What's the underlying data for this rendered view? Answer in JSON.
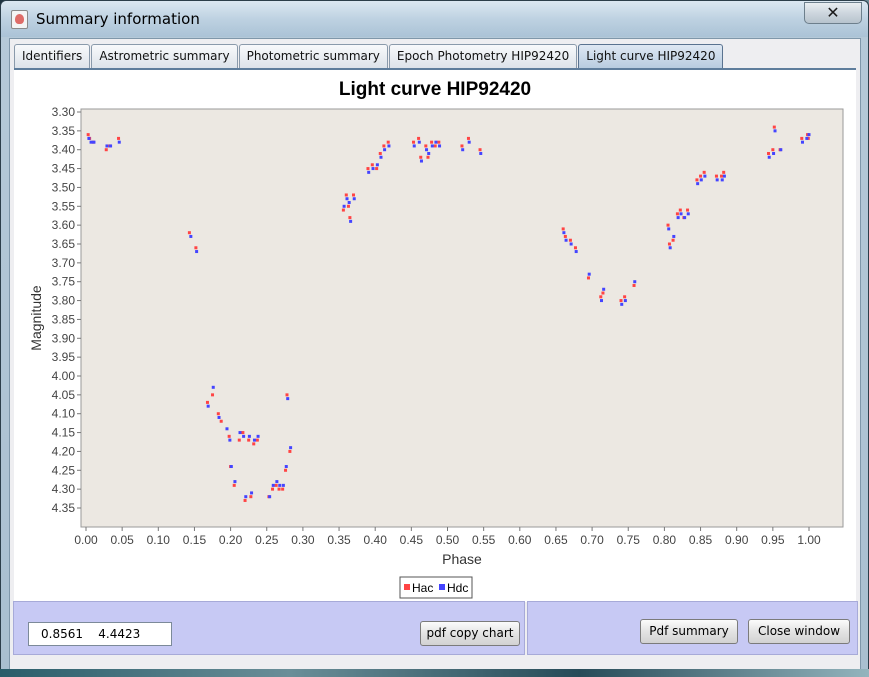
{
  "window": {
    "title": "Summary information",
    "close_icon": "close-icon",
    "app_icon": "java-cup-icon"
  },
  "tabs": [
    {
      "label": "Identifiers",
      "active": false
    },
    {
      "label": "Astrometric summary",
      "active": false
    },
    {
      "label": "Photometric summary",
      "active": false
    },
    {
      "label": "Epoch Photometry HIP92420",
      "active": false
    },
    {
      "label": "Light curve HIP92420",
      "active": true
    }
  ],
  "chart_data": {
    "type": "scatter",
    "title": "Light curve HIP92420",
    "xlabel": "Phase",
    "ylabel": "Magnitude",
    "xlim": [
      0.0,
      1.03
    ],
    "ylim": [
      4.37,
      3.3
    ],
    "y_inverted": true,
    "grid": false,
    "legend_position": "bottom-center",
    "x_ticks": [
      "0.00",
      "0.05",
      "0.10",
      "0.15",
      "0.20",
      "0.25",
      "0.30",
      "0.35",
      "0.40",
      "0.45",
      "0.50",
      "0.55",
      "0.60",
      "0.65",
      "0.70",
      "0.75",
      "0.80",
      "0.85",
      "0.90",
      "0.95",
      "1.00"
    ],
    "y_ticks": [
      "3.30",
      "3.35",
      "3.40",
      "3.45",
      "3.50",
      "3.55",
      "3.60",
      "3.65",
      "3.70",
      "3.75",
      "3.80",
      "3.85",
      "3.90",
      "3.95",
      "4.00",
      "4.05",
      "4.10",
      "4.15",
      "4.20",
      "4.25",
      "4.30",
      "4.35"
    ],
    "series": [
      {
        "name": "Hac",
        "color": "#ff4444",
        "points": [
          [
            0.003,
            3.36
          ],
          [
            0.005,
            3.37
          ],
          [
            0.01,
            3.38
          ],
          [
            0.028,
            3.4
          ],
          [
            0.033,
            3.39
          ],
          [
            0.045,
            3.37
          ],
          [
            0.143,
            3.62
          ],
          [
            0.152,
            3.66
          ],
          [
            0.168,
            4.07
          ],
          [
            0.175,
            4.05
          ],
          [
            0.183,
            4.1
          ],
          [
            0.187,
            4.12
          ],
          [
            0.198,
            4.16
          ],
          [
            0.2,
            4.24
          ],
          [
            0.205,
            4.29
          ],
          [
            0.212,
            4.17
          ],
          [
            0.217,
            4.15
          ],
          [
            0.22,
            4.33
          ],
          [
            0.225,
            4.17
          ],
          [
            0.228,
            4.32
          ],
          [
            0.232,
            4.18
          ],
          [
            0.237,
            4.17
          ],
          [
            0.253,
            4.32
          ],
          [
            0.258,
            4.3
          ],
          [
            0.263,
            4.29
          ],
          [
            0.267,
            4.3
          ],
          [
            0.272,
            4.3
          ],
          [
            0.276,
            4.25
          ],
          [
            0.278,
            4.05
          ],
          [
            0.282,
            4.2
          ],
          [
            0.356,
            3.56
          ],
          [
            0.36,
            3.52
          ],
          [
            0.363,
            3.55
          ],
          [
            0.365,
            3.58
          ],
          [
            0.37,
            3.52
          ],
          [
            0.39,
            3.45
          ],
          [
            0.396,
            3.44
          ],
          [
            0.402,
            3.45
          ],
          [
            0.407,
            3.41
          ],
          [
            0.412,
            3.39
          ],
          [
            0.418,
            3.38
          ],
          [
            0.453,
            3.38
          ],
          [
            0.46,
            3.37
          ],
          [
            0.463,
            3.42
          ],
          [
            0.47,
            3.39
          ],
          [
            0.473,
            3.42
          ],
          [
            0.478,
            3.38
          ],
          [
            0.483,
            3.39
          ],
          [
            0.488,
            3.38
          ],
          [
            0.52,
            3.39
          ],
          [
            0.529,
            3.37
          ],
          [
            0.545,
            3.4
          ],
          [
            0.66,
            3.61
          ],
          [
            0.663,
            3.63
          ],
          [
            0.67,
            3.64
          ],
          [
            0.677,
            3.66
          ],
          [
            0.695,
            3.74
          ],
          [
            0.712,
            3.79
          ],
          [
            0.715,
            3.78
          ],
          [
            0.74,
            3.8
          ],
          [
            0.745,
            3.79
          ],
          [
            0.758,
            3.76
          ],
          [
            0.805,
            3.6
          ],
          [
            0.807,
            3.65
          ],
          [
            0.812,
            3.64
          ],
          [
            0.818,
            3.57
          ],
          [
            0.822,
            3.56
          ],
          [
            0.827,
            3.58
          ],
          [
            0.832,
            3.56
          ],
          [
            0.845,
            3.48
          ],
          [
            0.85,
            3.47
          ],
          [
            0.855,
            3.46
          ],
          [
            0.872,
            3.47
          ],
          [
            0.879,
            3.47
          ],
          [
            0.882,
            3.46
          ],
          [
            0.944,
            3.41
          ],
          [
            0.95,
            3.4
          ],
          [
            0.952,
            3.34
          ],
          [
            0.96,
            3.4
          ],
          [
            0.99,
            3.37
          ],
          [
            0.998,
            3.36
          ],
          [
            0.999,
            3.37
          ]
        ]
      },
      {
        "name": "Hdc",
        "color": "#4444ff",
        "points": [
          [
            0.004,
            3.37
          ],
          [
            0.007,
            3.38
          ],
          [
            0.011,
            3.38
          ],
          [
            0.029,
            3.39
          ],
          [
            0.034,
            3.39
          ],
          [
            0.046,
            3.38
          ],
          [
            0.145,
            3.63
          ],
          [
            0.153,
            3.67
          ],
          [
            0.169,
            4.08
          ],
          [
            0.176,
            4.03
          ],
          [
            0.184,
            4.11
          ],
          [
            0.195,
            4.14
          ],
          [
            0.199,
            4.17
          ],
          [
            0.201,
            4.24
          ],
          [
            0.206,
            4.28
          ],
          [
            0.213,
            4.15
          ],
          [
            0.218,
            4.16
          ],
          [
            0.221,
            4.32
          ],
          [
            0.226,
            4.16
          ],
          [
            0.229,
            4.31
          ],
          [
            0.233,
            4.17
          ],
          [
            0.238,
            4.16
          ],
          [
            0.254,
            4.32
          ],
          [
            0.259,
            4.29
          ],
          [
            0.264,
            4.28
          ],
          [
            0.268,
            4.29
          ],
          [
            0.273,
            4.29
          ],
          [
            0.277,
            4.24
          ],
          [
            0.279,
            4.06
          ],
          [
            0.283,
            4.19
          ],
          [
            0.357,
            3.55
          ],
          [
            0.361,
            3.53
          ],
          [
            0.364,
            3.54
          ],
          [
            0.366,
            3.59
          ],
          [
            0.371,
            3.53
          ],
          [
            0.391,
            3.46
          ],
          [
            0.397,
            3.45
          ],
          [
            0.403,
            3.44
          ],
          [
            0.408,
            3.42
          ],
          [
            0.413,
            3.4
          ],
          [
            0.419,
            3.39
          ],
          [
            0.454,
            3.39
          ],
          [
            0.461,
            3.38
          ],
          [
            0.464,
            3.43
          ],
          [
            0.471,
            3.4
          ],
          [
            0.474,
            3.41
          ],
          [
            0.479,
            3.39
          ],
          [
            0.484,
            3.38
          ],
          [
            0.489,
            3.39
          ],
          [
            0.521,
            3.4
          ],
          [
            0.53,
            3.38
          ],
          [
            0.546,
            3.41
          ],
          [
            0.661,
            3.62
          ],
          [
            0.664,
            3.64
          ],
          [
            0.671,
            3.65
          ],
          [
            0.678,
            3.67
          ],
          [
            0.696,
            3.73
          ],
          [
            0.713,
            3.8
          ],
          [
            0.716,
            3.77
          ],
          [
            0.741,
            3.81
          ],
          [
            0.746,
            3.8
          ],
          [
            0.759,
            3.75
          ],
          [
            0.806,
            3.61
          ],
          [
            0.808,
            3.66
          ],
          [
            0.813,
            3.63
          ],
          [
            0.819,
            3.58
          ],
          [
            0.823,
            3.57
          ],
          [
            0.828,
            3.58
          ],
          [
            0.833,
            3.57
          ],
          [
            0.846,
            3.49
          ],
          [
            0.851,
            3.48
          ],
          [
            0.856,
            3.47
          ],
          [
            0.873,
            3.48
          ],
          [
            0.88,
            3.48
          ],
          [
            0.883,
            3.47
          ],
          [
            0.945,
            3.42
          ],
          [
            0.951,
            3.41
          ],
          [
            0.953,
            3.35
          ],
          [
            0.961,
            3.4
          ],
          [
            0.991,
            3.38
          ],
          [
            0.997,
            3.37
          ],
          [
            1.0,
            3.36
          ]
        ]
      }
    ]
  },
  "footer": {
    "coordinate_readout": "0.8561    4.4423",
    "pdf_copy_chart_label": "pdf copy chart",
    "pdf_summary_label": "Pdf summary",
    "close_window_label": "Close window"
  },
  "colors": {
    "plot_background": "#ece8e2",
    "bottom_panel": "#c7c9f4",
    "active_tab": "#b8cce0"
  }
}
